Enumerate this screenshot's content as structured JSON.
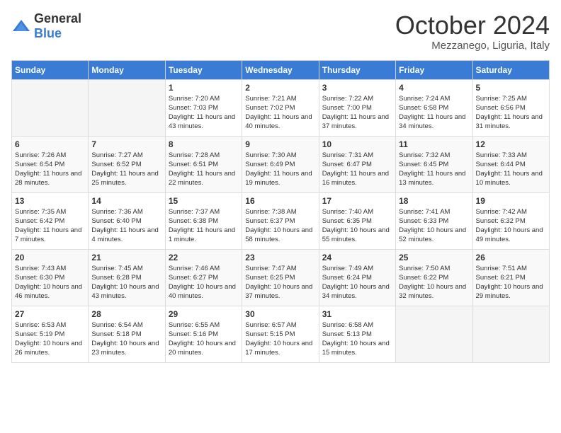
{
  "logo": {
    "general": "General",
    "blue": "Blue"
  },
  "title": "October 2024",
  "location": "Mezzanego, Liguria, Italy",
  "days_of_week": [
    "Sunday",
    "Monday",
    "Tuesday",
    "Wednesday",
    "Thursday",
    "Friday",
    "Saturday"
  ],
  "weeks": [
    [
      {
        "day": "",
        "info": ""
      },
      {
        "day": "",
        "info": ""
      },
      {
        "day": "1",
        "info": "Sunrise: 7:20 AM\nSunset: 7:03 PM\nDaylight: 11 hours and 43 minutes."
      },
      {
        "day": "2",
        "info": "Sunrise: 7:21 AM\nSunset: 7:02 PM\nDaylight: 11 hours and 40 minutes."
      },
      {
        "day": "3",
        "info": "Sunrise: 7:22 AM\nSunset: 7:00 PM\nDaylight: 11 hours and 37 minutes."
      },
      {
        "day": "4",
        "info": "Sunrise: 7:24 AM\nSunset: 6:58 PM\nDaylight: 11 hours and 34 minutes."
      },
      {
        "day": "5",
        "info": "Sunrise: 7:25 AM\nSunset: 6:56 PM\nDaylight: 11 hours and 31 minutes."
      }
    ],
    [
      {
        "day": "6",
        "info": "Sunrise: 7:26 AM\nSunset: 6:54 PM\nDaylight: 11 hours and 28 minutes."
      },
      {
        "day": "7",
        "info": "Sunrise: 7:27 AM\nSunset: 6:52 PM\nDaylight: 11 hours and 25 minutes."
      },
      {
        "day": "8",
        "info": "Sunrise: 7:28 AM\nSunset: 6:51 PM\nDaylight: 11 hours and 22 minutes."
      },
      {
        "day": "9",
        "info": "Sunrise: 7:30 AM\nSunset: 6:49 PM\nDaylight: 11 hours and 19 minutes."
      },
      {
        "day": "10",
        "info": "Sunrise: 7:31 AM\nSunset: 6:47 PM\nDaylight: 11 hours and 16 minutes."
      },
      {
        "day": "11",
        "info": "Sunrise: 7:32 AM\nSunset: 6:45 PM\nDaylight: 11 hours and 13 minutes."
      },
      {
        "day": "12",
        "info": "Sunrise: 7:33 AM\nSunset: 6:44 PM\nDaylight: 11 hours and 10 minutes."
      }
    ],
    [
      {
        "day": "13",
        "info": "Sunrise: 7:35 AM\nSunset: 6:42 PM\nDaylight: 11 hours and 7 minutes."
      },
      {
        "day": "14",
        "info": "Sunrise: 7:36 AM\nSunset: 6:40 PM\nDaylight: 11 hours and 4 minutes."
      },
      {
        "day": "15",
        "info": "Sunrise: 7:37 AM\nSunset: 6:38 PM\nDaylight: 11 hours and 1 minute."
      },
      {
        "day": "16",
        "info": "Sunrise: 7:38 AM\nSunset: 6:37 PM\nDaylight: 10 hours and 58 minutes."
      },
      {
        "day": "17",
        "info": "Sunrise: 7:40 AM\nSunset: 6:35 PM\nDaylight: 10 hours and 55 minutes."
      },
      {
        "day": "18",
        "info": "Sunrise: 7:41 AM\nSunset: 6:33 PM\nDaylight: 10 hours and 52 minutes."
      },
      {
        "day": "19",
        "info": "Sunrise: 7:42 AM\nSunset: 6:32 PM\nDaylight: 10 hours and 49 minutes."
      }
    ],
    [
      {
        "day": "20",
        "info": "Sunrise: 7:43 AM\nSunset: 6:30 PM\nDaylight: 10 hours and 46 minutes."
      },
      {
        "day": "21",
        "info": "Sunrise: 7:45 AM\nSunset: 6:28 PM\nDaylight: 10 hours and 43 minutes."
      },
      {
        "day": "22",
        "info": "Sunrise: 7:46 AM\nSunset: 6:27 PM\nDaylight: 10 hours and 40 minutes."
      },
      {
        "day": "23",
        "info": "Sunrise: 7:47 AM\nSunset: 6:25 PM\nDaylight: 10 hours and 37 minutes."
      },
      {
        "day": "24",
        "info": "Sunrise: 7:49 AM\nSunset: 6:24 PM\nDaylight: 10 hours and 34 minutes."
      },
      {
        "day": "25",
        "info": "Sunrise: 7:50 AM\nSunset: 6:22 PM\nDaylight: 10 hours and 32 minutes."
      },
      {
        "day": "26",
        "info": "Sunrise: 7:51 AM\nSunset: 6:21 PM\nDaylight: 10 hours and 29 minutes."
      }
    ],
    [
      {
        "day": "27",
        "info": "Sunrise: 6:53 AM\nSunset: 5:19 PM\nDaylight: 10 hours and 26 minutes."
      },
      {
        "day": "28",
        "info": "Sunrise: 6:54 AM\nSunset: 5:18 PM\nDaylight: 10 hours and 23 minutes."
      },
      {
        "day": "29",
        "info": "Sunrise: 6:55 AM\nSunset: 5:16 PM\nDaylight: 10 hours and 20 minutes."
      },
      {
        "day": "30",
        "info": "Sunrise: 6:57 AM\nSunset: 5:15 PM\nDaylight: 10 hours and 17 minutes."
      },
      {
        "day": "31",
        "info": "Sunrise: 6:58 AM\nSunset: 5:13 PM\nDaylight: 10 hours and 15 minutes."
      },
      {
        "day": "",
        "info": ""
      },
      {
        "day": "",
        "info": ""
      }
    ]
  ]
}
